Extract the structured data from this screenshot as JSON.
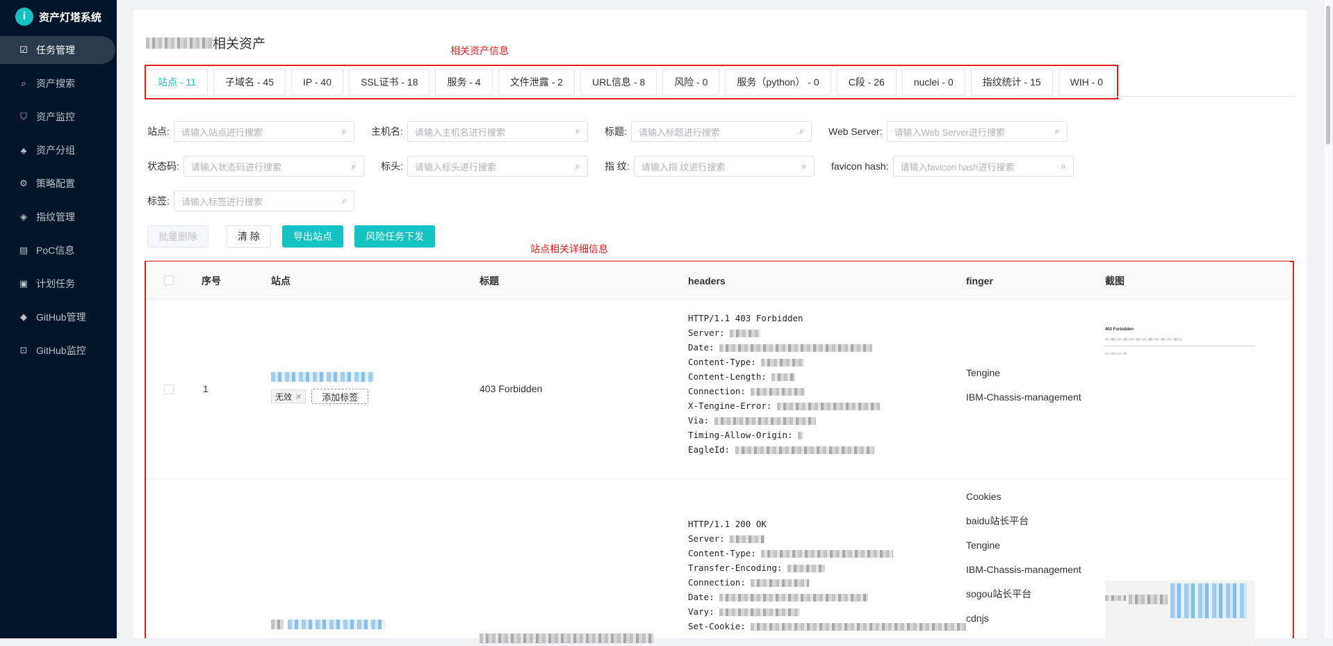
{
  "app": {
    "title": "资产灯塔系统",
    "logo_char": "i"
  },
  "sidebar": {
    "items": [
      {
        "label": "任务管理",
        "icon": "task-icon",
        "glyph": "☑",
        "active": true
      },
      {
        "label": "资产搜索",
        "icon": "search-icon",
        "glyph": "⌕"
      },
      {
        "label": "资产监控",
        "icon": "shield-icon",
        "glyph": "⛉"
      },
      {
        "label": "资产分组",
        "icon": "tree-icon",
        "glyph": "♣"
      },
      {
        "label": "策略配置",
        "icon": "gear-icon",
        "glyph": "⚙"
      },
      {
        "label": "指纹管理",
        "icon": "tag-icon",
        "glyph": "◈"
      },
      {
        "label": "PoC信息",
        "icon": "document-icon",
        "glyph": "▤"
      },
      {
        "label": "计划任务",
        "icon": "terminal-icon",
        "glyph": "▣"
      },
      {
        "label": "GitHub管理",
        "icon": "git-icon",
        "glyph": "◆"
      },
      {
        "label": "GitHub监控",
        "icon": "monitor-icon",
        "glyph": "⊡"
      }
    ]
  },
  "page": {
    "title_suffix": "相关资产"
  },
  "annotations": {
    "tabs_note": "相关资产信息",
    "table_note": "站点相关详细信息"
  },
  "tabs": [
    {
      "label": "站点 - 11",
      "active": true
    },
    {
      "label": "子域名 - 45"
    },
    {
      "label": "IP - 40"
    },
    {
      "label": "SSL证书 - 18"
    },
    {
      "label": "服务 - 4"
    },
    {
      "label": "文件泄露 - 2"
    },
    {
      "label": "URL信息 - 8"
    },
    {
      "label": "风险 - 0"
    },
    {
      "label": "服务（python） - 0"
    },
    {
      "label": "C段 - 26"
    },
    {
      "label": "nuclei - 0"
    },
    {
      "label": "指纹统计 - 15"
    },
    {
      "label": "WIH - 0"
    }
  ],
  "filters": {
    "site": {
      "label": "站点:",
      "placeholder": "请输入站点进行搜索"
    },
    "hostname": {
      "label": "主机名:",
      "placeholder": "请输入主机名进行搜索"
    },
    "title": {
      "label": "标题:",
      "placeholder": "请输入标题进行搜索"
    },
    "webserver": {
      "label": "Web Server:",
      "placeholder": "请输入Web Server进行搜索"
    },
    "status": {
      "label": "状态码:",
      "placeholder": "请输入状态码进行搜索"
    },
    "header": {
      "label": "标头:",
      "placeholder": "请输入标头进行搜索"
    },
    "finger": {
      "label": "指 纹:",
      "placeholder": "请输入指 纹进行搜索"
    },
    "favicon": {
      "label": "favicon hash:",
      "placeholder": "请输入favicon hash进行搜索"
    },
    "tag": {
      "label": "标签:",
      "placeholder": "请输入标签进行搜索"
    }
  },
  "actions": {
    "batch_delete": "批量删除",
    "clear": "清 除",
    "export": "导出站点",
    "risk_task": "风险任务下发"
  },
  "table": {
    "columns": {
      "index": "序号",
      "site": "站点",
      "title": "标题",
      "headers": "headers",
      "finger": "finger",
      "screenshot": "截图"
    },
    "rows": [
      {
        "index": "1",
        "title": "403 Forbidden",
        "tag": "无效",
        "add_tag": "添加标签",
        "headers": [
          "HTTP/1.1 403 Forbidden",
          "Server:",
          "Date:",
          "Content-Type:",
          "Content-Length:",
          "Connection:",
          "X-Tengine-Error:",
          "Via:",
          "Timing-Allow-Origin:",
          "EagleId:"
        ],
        "fingers": [
          "Tengine",
          "IBM-Chassis-management"
        ],
        "screenshot_heading": "403 Forbidden"
      },
      {
        "index": "",
        "title": "",
        "headers": [
          "HTTP/1.1 200 OK",
          "Server:",
          "Content-Type:",
          "Transfer-Encoding:",
          "Connection:",
          "Date:",
          "Vary:",
          "Set-Cookie:"
        ],
        "fingers": [
          "Cookies",
          "baidu站长平台",
          "Tengine",
          "IBM-Chassis-management",
          "sogou站长平台",
          "cdnjs"
        ]
      }
    ]
  },
  "colors": {
    "accent": "#13c2c2",
    "sidebar_bg": "#001529",
    "annotation": "#e02020"
  }
}
